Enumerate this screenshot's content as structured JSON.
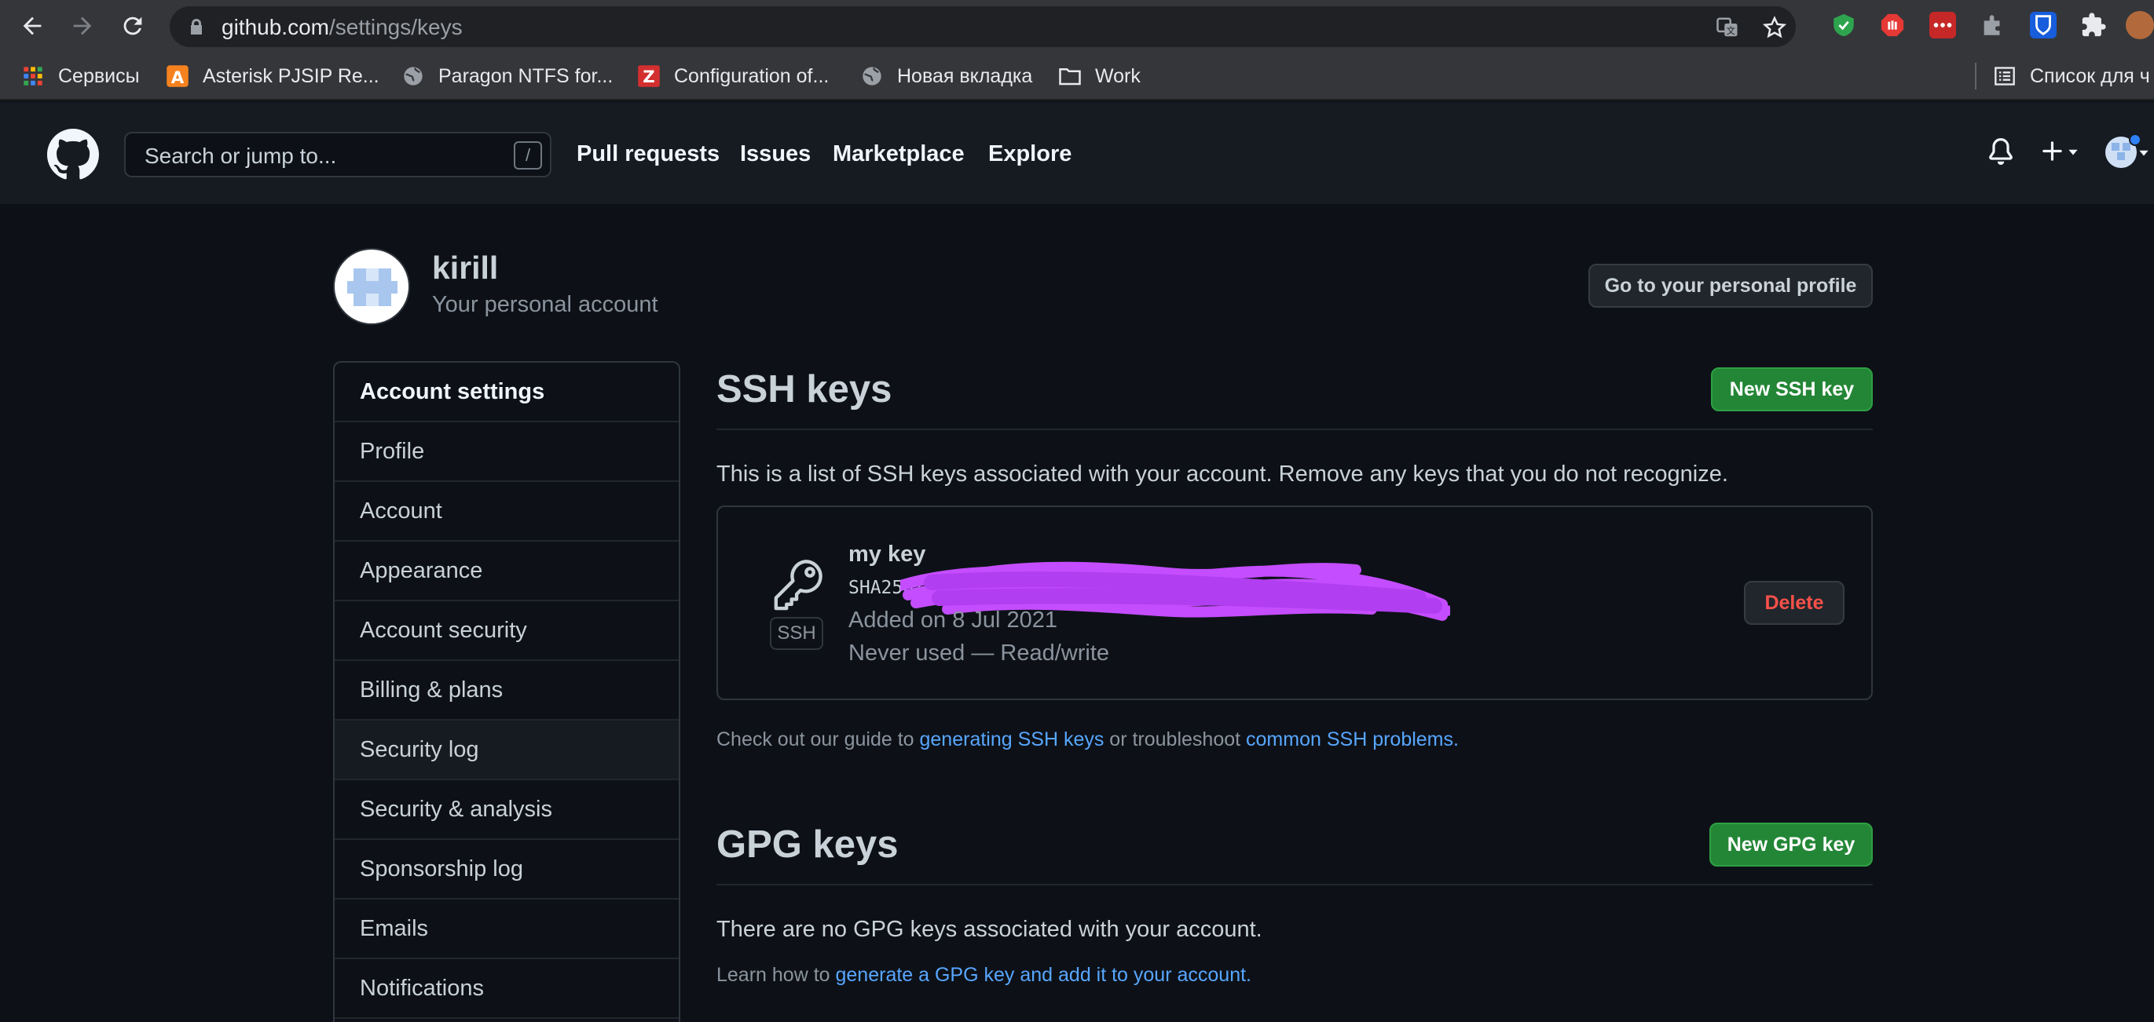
{
  "browser": {
    "url_host": "github.com",
    "url_path": "/settings/keys",
    "bookmarks": [
      {
        "label": "Сервисы",
        "icon": "apps-grid-icon"
      },
      {
        "label": "Asterisk PJSIP Re...",
        "icon": "asterisk-icon"
      },
      {
        "label": "Paragon NTFS for...",
        "icon": "globe-icon"
      },
      {
        "label": "Configuration of...",
        "icon": "zoho-icon"
      },
      {
        "label": "Новая вкладка",
        "icon": "globe-icon"
      },
      {
        "label": "Work",
        "icon": "folder-icon"
      }
    ],
    "reading_list": "Список для ч"
  },
  "header": {
    "search_placeholder": "Search or jump to...",
    "search_shortcut": "/",
    "nav": [
      "Pull requests",
      "Issues",
      "Marketplace",
      "Explore"
    ]
  },
  "account": {
    "username": "kirill",
    "subtitle": "Your personal account",
    "profile_button": "Go to your personal profile"
  },
  "sidebar": {
    "heading": "Account settings",
    "items": [
      "Profile",
      "Account",
      "Appearance",
      "Account security",
      "Billing & plans",
      "Security log",
      "Security & analysis",
      "Sponsorship log",
      "Emails",
      "Notifications"
    ]
  },
  "ssh": {
    "title": "SSH keys",
    "new_button": "New SSH key",
    "description": "This is a list of SSH keys associated with your account. Remove any keys that you do not recognize.",
    "key": {
      "title": "my key",
      "fingerprint_prefix": "SHA256:",
      "badge": "SSH",
      "added": "Added on 8 Jul 2021",
      "usage": "Never used — Read/write",
      "delete_button": "Delete"
    },
    "guide_prefix": "Check out our guide to ",
    "guide_link": "generating SSH keys",
    "guide_middle": " or troubleshoot ",
    "guide_link2": "common SSH problems",
    "guide_suffix": "."
  },
  "gpg": {
    "title": "GPG keys",
    "new_button": "New GPG key",
    "empty_text": "There are no GPG keys associated with your account.",
    "learn_prefix": "Learn how to ",
    "learn_link": "generate a GPG key and add it to your account",
    "learn_suffix": "."
  },
  "colors": {
    "background": "#0d1117",
    "header": "#161b22",
    "primary_button": "#238636",
    "link": "#58a6ff",
    "danger": "#f85149",
    "redaction": "#c44dff"
  }
}
